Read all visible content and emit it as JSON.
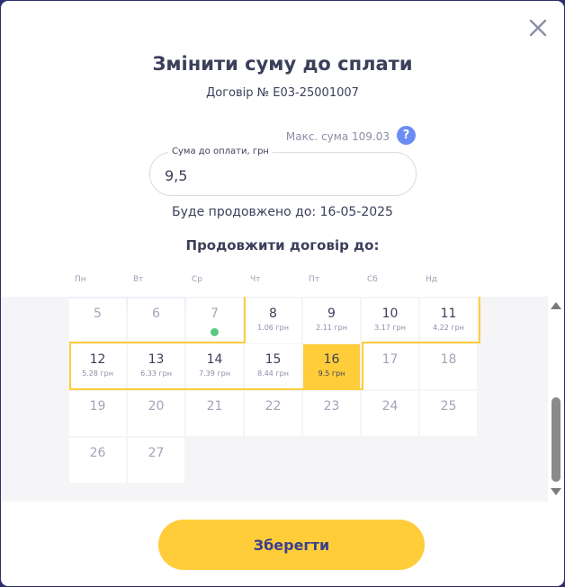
{
  "modal": {
    "title": "Змінити суму до сплати",
    "subtitle": "Договір № E03-25001007",
    "max_sum": "Макс. сума 109.03",
    "help_icon_text": "?",
    "input_label": "Сума до оплати, грн",
    "input_value": "9,5",
    "extended_text": "Буде продовжено до: 16-05-2025",
    "extend_title": "Продовжити договір до:",
    "save_label": "Зберегти"
  },
  "icons": {
    "close": "close-icon",
    "help": "question-icon",
    "today_marker": "dot-icon"
  },
  "colors": {
    "accent": "#ffcd3a",
    "help": "#6b8cf5",
    "today_dot": "#5cc782",
    "button_text": "#3b3f8f",
    "text": "#3c3f5a"
  },
  "calendar": {
    "weekdays": [
      "Пн",
      "Вт",
      "Ср",
      "Чт",
      "Пт",
      "Сб",
      "Нд"
    ],
    "rows": [
      [
        {
          "day": "5",
          "amount": "",
          "state": "disabled"
        },
        {
          "day": "6",
          "amount": "",
          "state": "disabled"
        },
        {
          "day": "7",
          "amount": "",
          "state": "today"
        },
        {
          "day": "8",
          "amount": "1.06 грн",
          "state": "available"
        },
        {
          "day": "9",
          "amount": "2.11 грн",
          "state": "available"
        },
        {
          "day": "10",
          "amount": "3.17 грн",
          "state": "available"
        },
        {
          "day": "11",
          "amount": "4.22 грн",
          "state": "available"
        }
      ],
      [
        {
          "day": "12",
          "amount": "5.28 грн",
          "state": "available"
        },
        {
          "day": "13",
          "amount": "6.33 грн",
          "state": "available"
        },
        {
          "day": "14",
          "amount": "7.39 грн",
          "state": "available"
        },
        {
          "day": "15",
          "amount": "8.44 грн",
          "state": "available"
        },
        {
          "day": "16",
          "amount": "9.5 грн",
          "state": "selected"
        },
        {
          "day": "17",
          "amount": "",
          "state": "disabled"
        },
        {
          "day": "18",
          "amount": "",
          "state": "disabled"
        }
      ],
      [
        {
          "day": "19",
          "amount": "",
          "state": "disabled"
        },
        {
          "day": "20",
          "amount": "",
          "state": "disabled"
        },
        {
          "day": "21",
          "amount": "",
          "state": "disabled"
        },
        {
          "day": "22",
          "amount": "",
          "state": "disabled"
        },
        {
          "day": "23",
          "amount": "",
          "state": "disabled"
        },
        {
          "day": "24",
          "amount": "",
          "state": "disabled"
        },
        {
          "day": "25",
          "amount": "",
          "state": "disabled"
        }
      ],
      [
        {
          "day": "26",
          "amount": "",
          "state": "disabled"
        },
        {
          "day": "27",
          "amount": "",
          "state": "disabled"
        }
      ]
    ]
  }
}
